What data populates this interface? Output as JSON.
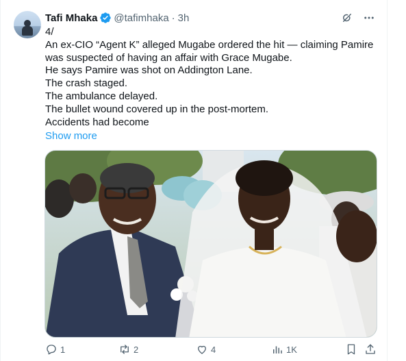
{
  "author": {
    "name": "Tafi Mhaka",
    "handle": "@tafimhaka",
    "separator": "·",
    "time": "3h"
  },
  "post": {
    "lines": [
      "4/",
      "An ex-CIO “Agent K” alleged Mugabe ordered the hit — claiming Pamire",
      "was suspected of having an affair with Grace Mugabe.",
      "He says Pamire was shot on Addington Lane.",
      "The crash staged.",
      "The ambulance delayed.",
      "The bullet wound covered up in the post-mortem.",
      "Accidents had become"
    ],
    "show_more": "Show more"
  },
  "actions": {
    "replies": "1",
    "reposts": "2",
    "likes": "4",
    "views": "1K"
  },
  "icons": {
    "verified": "verified-badge-icon",
    "grok": "grok-icon",
    "more": "more-icon",
    "reply": "reply-icon",
    "repost": "repost-icon",
    "like": "heart-icon",
    "views": "views-icon",
    "bookmark": "bookmark-icon",
    "share": "share-icon"
  },
  "colors": {
    "accent": "#1d9bf0",
    "text": "#0f1419",
    "muted": "#536471"
  }
}
